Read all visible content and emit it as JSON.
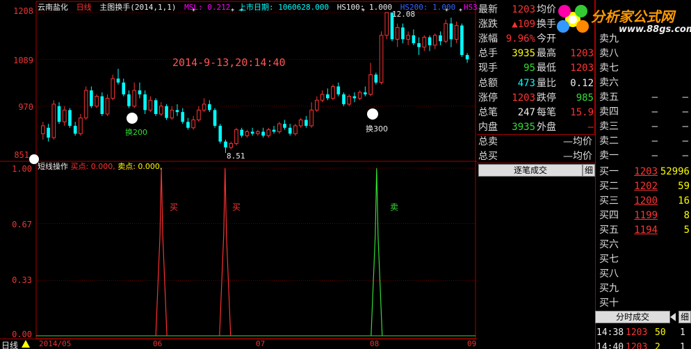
{
  "header": {
    "stock_name": "云南盐化",
    "period": "日线",
    "indicator": "主图换手(2014,1,1)",
    "msl": "MSL: 0.212",
    "listing_label": "上市日期: 1060628.000",
    "hs100": "HS100: 1.000",
    "hs200": "HS200: 1.000",
    "hs300": "HS300: 1"
  },
  "main_chart": {
    "y_ticks": [
      "1208",
      "1089",
      "970",
      "851"
    ],
    "timestamp": "2014-9-13,20:14:40",
    "high_marker": "12.08",
    "low_marker": "8.51",
    "turnover_200_label": "换200",
    "turnover_300_label": "换300"
  },
  "chart_data": [
    {
      "type": "candlestick",
      "title": "云南盐化 日线",
      "ylim": [
        851,
        1208
      ],
      "x_ticks": [
        "2014/05",
        "06",
        "07",
        "08",
        "09"
      ],
      "candles": [
        [
          900,
          920,
          885,
          930
        ],
        [
          915,
          890,
          880,
          925
        ],
        [
          890,
          975,
          885,
          985
        ],
        [
          970,
          930,
          925,
          980
        ],
        [
          930,
          960,
          920,
          970
        ],
        [
          960,
          920,
          915,
          965
        ],
        [
          920,
          900,
          895,
          930
        ],
        [
          900,
          940,
          895,
          950
        ],
        [
          940,
          1010,
          935,
          1020
        ],
        [
          1010,
          970,
          965,
          1020
        ],
        [
          970,
          995,
          965,
          1000
        ],
        [
          995,
          950,
          945,
          1005
        ],
        [
          950,
          990,
          945,
          1000
        ],
        [
          990,
          1040,
          985,
          1050
        ],
        [
          1040,
          1030,
          1025,
          1065
        ],
        [
          1030,
          1000,
          995,
          1040
        ],
        [
          1000,
          970,
          965,
          1010
        ],
        [
          970,
          1010,
          965,
          1030
        ],
        [
          1010,
          1000,
          990,
          1030
        ],
        [
          1000,
          960,
          950,
          1010
        ],
        [
          960,
          985,
          955,
          995
        ],
        [
          985,
          950,
          945,
          990
        ],
        [
          950,
          970,
          945,
          980
        ],
        [
          970,
          940,
          935,
          975
        ],
        [
          940,
          960,
          935,
          970
        ],
        [
          960,
          955,
          945,
          975
        ],
        [
          955,
          930,
          925,
          965
        ],
        [
          930,
          915,
          910,
          940
        ],
        [
          915,
          935,
          910,
          945
        ],
        [
          935,
          960,
          930,
          970
        ],
        [
          960,
          975,
          955,
          990
        ],
        [
          975,
          960,
          955,
          985
        ],
        [
          960,
          920,
          915,
          965
        ],
        [
          920,
          880,
          875,
          925
        ],
        [
          880,
          865,
          851,
          885
        ],
        [
          865,
          875,
          860,
          880
        ],
        [
          875,
          910,
          870,
          915
        ],
        [
          910,
          895,
          890,
          915
        ],
        [
          895,
          905,
          890,
          910
        ],
        [
          905,
          900,
          895,
          915
        ],
        [
          900,
          905,
          895,
          910
        ],
        [
          905,
          895,
          890,
          915
        ],
        [
          895,
          910,
          890,
          915
        ],
        [
          910,
          905,
          900,
          920
        ],
        [
          905,
          925,
          900,
          930
        ],
        [
          925,
          915,
          910,
          935
        ],
        [
          915,
          900,
          895,
          925
        ],
        [
          900,
          920,
          895,
          925
        ],
        [
          920,
          935,
          915,
          940
        ],
        [
          935,
          920,
          915,
          945
        ],
        [
          920,
          960,
          915,
          980
        ],
        [
          960,
          985,
          955,
          995
        ],
        [
          985,
          1000,
          980,
          1010
        ],
        [
          1000,
          990,
          985,
          1015
        ],
        [
          990,
          1020,
          985,
          1025
        ],
        [
          1020,
          1000,
          995,
          1030
        ],
        [
          1000,
          975,
          970,
          1005
        ],
        [
          975,
          995,
          970,
          1000
        ],
        [
          995,
          990,
          980,
          1005
        ],
        [
          990,
          1005,
          985,
          1010
        ],
        [
          1005,
          1000,
          995,
          1020
        ],
        [
          1000,
          1050,
          995,
          1080
        ],
        [
          1050,
          1030,
          1025,
          1055
        ],
        [
          1030,
          1150,
          1025,
          1160
        ],
        [
          1150,
          1208,
          1140,
          1208
        ],
        [
          1208,
          1140,
          1135,
          1190
        ],
        [
          1140,
          1170,
          1120,
          1180
        ],
        [
          1170,
          1140,
          1130,
          1180
        ],
        [
          1140,
          1150,
          1125,
          1160
        ],
        [
          1150,
          1130,
          1125,
          1165
        ],
        [
          1130,
          1120,
          1100,
          1145
        ],
        [
          1120,
          1145,
          1110,
          1150
        ],
        [
          1145,
          1125,
          1110,
          1150
        ],
        [
          1125,
          1150,
          1115,
          1155
        ],
        [
          1150,
          1135,
          1125,
          1160
        ],
        [
          1135,
          1180,
          1130,
          1190
        ],
        [
          1180,
          1140,
          1120,
          1195
        ],
        [
          1140,
          1175,
          1130,
          1185
        ],
        [
          1175,
          1100,
          1095,
          1180
        ],
        [
          1100,
          1089,
          1080,
          1105
        ]
      ]
    },
    {
      "type": "line",
      "title": "短线操作",
      "ylim": [
        0,
        1
      ],
      "y_ticks": [
        "1.00",
        "0.67",
        "0.33",
        "0.00"
      ],
      "series": [
        {
          "name": "买点",
          "color": "#ff3030",
          "pulse_centers": [
            0.285,
            0.43
          ]
        },
        {
          "name": "卖点",
          "color": "#33dd33",
          "pulse_centers": [
            0.775
          ]
        }
      ]
    }
  ],
  "sub_chart": {
    "title": "短线操作",
    "buy_label": "买点: 0.000,",
    "sell_label": "卖点: 0.000,",
    "buy_text": "买",
    "sell_text": "卖",
    "y_ticks": [
      "1.00",
      "0.67",
      "0.33",
      "0.00"
    ]
  },
  "bottom_bar": {
    "period_tab": "日线",
    "date_ticks": [
      "2014/05",
      "06",
      "07",
      "08",
      "09"
    ]
  },
  "quote_panel": {
    "rows": [
      {
        "l1": "最新",
        "v1": "1203",
        "l2": "均价",
        "v2": ""
      },
      {
        "l1": "涨跌",
        "v1": "▲109",
        "l2": "换手",
        "v2": ""
      },
      {
        "l1": "涨幅",
        "v1": "9.96%",
        "l2": "今开",
        "v2": ""
      },
      {
        "l1": "总手",
        "v1": "3935",
        "l2": "最高",
        "v2": "1203"
      },
      {
        "l1": "现手",
        "v1": "95",
        "l2": "最低",
        "v2": "1203"
      },
      {
        "l1": "总额",
        "v1": "473",
        "l2": "量比",
        "v2": "0.12"
      },
      {
        "l1": "涨停",
        "v1": "1203",
        "l2": "跌停",
        "v2": "985"
      },
      {
        "l1": "总笔",
        "v1": "247",
        "l2": "每笔",
        "v2": "15.9"
      },
      {
        "l1": "内盘",
        "v1": "3935",
        "l2": "外盘",
        "v2": "—"
      }
    ],
    "sell_total_label": "总卖",
    "sell_total_value": "—均价",
    "buy_total_label": "总买",
    "buy_total_value": "—均价",
    "ticks_button": "逐笔成交",
    "detail_button": "细"
  },
  "order_book": {
    "sells": [
      {
        "label": "卖九",
        "price": "",
        "vol": ""
      },
      {
        "label": "卖八",
        "price": "",
        "vol": ""
      },
      {
        "label": "卖七",
        "price": "",
        "vol": ""
      },
      {
        "label": "卖六",
        "price": "",
        "vol": ""
      },
      {
        "label": "卖五",
        "price": "—",
        "vol": "—"
      },
      {
        "label": "卖四",
        "price": "—",
        "vol": "—"
      },
      {
        "label": "卖三",
        "price": "—",
        "vol": "—"
      },
      {
        "label": "卖二",
        "price": "—",
        "vol": "—"
      },
      {
        "label": "卖一",
        "price": "—",
        "vol": "—"
      }
    ],
    "buys": [
      {
        "label": "买一",
        "price": "1203",
        "vol": "52996"
      },
      {
        "label": "买二",
        "price": "1202",
        "vol": "59"
      },
      {
        "label": "买三",
        "price": "1200",
        "vol": "16"
      },
      {
        "label": "买四",
        "price": "1199",
        "vol": "8"
      },
      {
        "label": "买五",
        "price": "1194",
        "vol": "5"
      },
      {
        "label": "买六",
        "price": "",
        "vol": ""
      },
      {
        "label": "买七",
        "price": "",
        "vol": ""
      },
      {
        "label": "买八",
        "price": "",
        "vol": ""
      },
      {
        "label": "买九",
        "price": "",
        "vol": ""
      },
      {
        "label": "买十",
        "price": "",
        "vol": ""
      }
    ],
    "timeshare_button": "分时成交",
    "detail_button": "细",
    "trades": [
      {
        "time": "14:38",
        "price": "1203",
        "vol": "50",
        "n": "1"
      },
      {
        "time": "14:40",
        "price": "1203",
        "vol": "2",
        "n": "1"
      }
    ]
  },
  "watermark": {
    "title": "分析家公式网",
    "url": "www.88gs.com"
  }
}
